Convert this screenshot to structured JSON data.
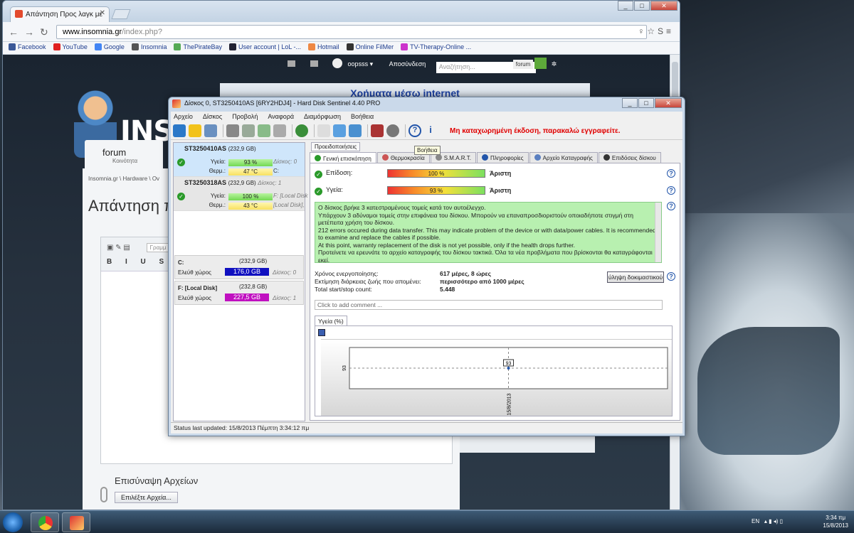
{
  "browser": {
    "tab_title": "Απάντηση Προς λαγκ με",
    "url_host": "www.insomnia.gr",
    "url_path": "/index.php?",
    "bookmarks": [
      "Facebook",
      "YouTube",
      "Google",
      "Insomnia",
      "ThePirateBay",
      "User account | LoL -...",
      "Hotmail",
      "Online FilMer",
      "TV-Therapy-Online ..."
    ]
  },
  "site": {
    "username": "oopsss",
    "logout": "Αποσύνδεση",
    "search_placeholder": "Αναζήτηση...",
    "search_scope": "forum",
    "logo_text": "INSOMNIA",
    "ad_text": "Χρήματα μέσω internet",
    "forum_tab": "forum",
    "forum_sub": "Κοινότητα",
    "breadcrumb": "Insomnia.gr  \\  Hardware  \\  Ov",
    "page_title": "Απάντηση π",
    "format_placeholder": "Γραμμ",
    "attachments_label": "Επισύναψη Αρχείων",
    "choose_files": "Επιλέξτε Αρχεία..."
  },
  "hds": {
    "title": "Δίσκος 0, ST3250410AS [6RY2HDJ4] - Hard Disk Sentinel 4.40 PRO",
    "menu": [
      "Αρχείο",
      "Δίσκος",
      "Προβολή",
      "Αναφορά",
      "Διαμόρφωση",
      "Βοήθεια"
    ],
    "register_msg": "Μη καταχωρημένη έκδοση, παρακαλώ εγγραφείτε.",
    "tooltip": "Βοήθεια",
    "disks": [
      {
        "name": "ST3250410AS",
        "size": "(232,9 GB)",
        "health_label": "Υγεία:",
        "health": "93 %",
        "temp_label": "Θερμ.:",
        "temp": "47 °C",
        "disk_ref": "Δίσκος: 0",
        "drive": "C:"
      },
      {
        "name": "ST3250318AS",
        "size": "(232,9 GB)",
        "health_label": "Υγεία:",
        "health": "100 %",
        "temp_label": "Θερμ.:",
        "temp": "43 °C",
        "disk_ref": "F: [Local Disk",
        "drive": "[Local Disk],"
      }
    ],
    "disk2_ref": "Δίσκος: 1",
    "volumes": [
      {
        "name": "C:",
        "size": "(232,9 GB)",
        "free_label": "Ελεύθ χώρος",
        "free": "176,0 GB",
        "ref": "Δίσκος: 0",
        "color": "#1010c0"
      },
      {
        "name": "F: [Local Disk]",
        "size": "(232,8 GB)",
        "free_label": "Ελεύθ χώρος",
        "free": "227,5 GB",
        "ref": "Δίσκος: 1",
        "color": "#c010c0"
      }
    ],
    "pre_tab": "Προειδοποιήσεις",
    "tabs": [
      "Γενική επισκόπηση",
      "Θερμοκρασία",
      "S.M.A.R.T.",
      "Πληροφορίες",
      "Αρχείο Καταγραφής",
      "Επιδόσεις δίσκου"
    ],
    "performance_label": "Επίδοση:",
    "performance_value": "100 %",
    "performance_pct": 100,
    "performance_rating": "Άριστη",
    "health_label": "Υγεία:",
    "health_value": "93 %",
    "health_pct": 93,
    "health_rating": "Άριστη",
    "message": [
      "Ο δίσκος βρήκε 3 κατεστραμένους τομείς κατά τον αυτοέλεγχο.",
      "Υπάρχουν 3 αδύναμοι τομείς στην επιφάνεια του δίσκου. Μπορούν να επαναπροσδιοριστούν οποιαδήποτε στιγμή στη μετέπειτα χρήση του δίσκου.",
      "212 errors occured during data transfer. This may indicate problem of the device or with data/power cables. It is recommended to examine and replace the cables if possible.",
      "At this point, warranty replacement of the disk is not yet possible, only if the health drops further.",
      "Προτείνετε να ερευνάτε το αρχείο καταγραφής του δίσκου τακτικά. Όλα τα νέα προβλήματα που βρίσκονται θα καταγράφονται εκεί."
    ],
    "uptime_label": "Χρόνος ενεργοποίησης:",
    "uptime": "617 μέρες, 8 ώρες",
    "lifetime_label": "Εκτίμηση διάρκειας ζωής που απομένει:",
    "lifetime": "περισσότερο από 1000 μέρες",
    "startstop_label": "Total start/stop count:",
    "startstop": "5.448",
    "test_button": "ύληψη δοκιμαστικού",
    "comment_placeholder": "Click to add comment ...",
    "chart_tab": "Υγεία (%)",
    "status": "Status last updated: 15/8/2013 Πέμπτη 3:34:12 πμ"
  },
  "chart_data": {
    "type": "line",
    "title": "",
    "xlabel": "",
    "ylabel": "",
    "x": [
      "15/8/2013"
    ],
    "series": [
      {
        "values": [
          93
        ]
      }
    ],
    "ylim": [
      92,
      94
    ],
    "grid": true
  },
  "taskbar": {
    "lang": "EN",
    "time": "3:34 πμ",
    "date": "15/8/2013"
  }
}
